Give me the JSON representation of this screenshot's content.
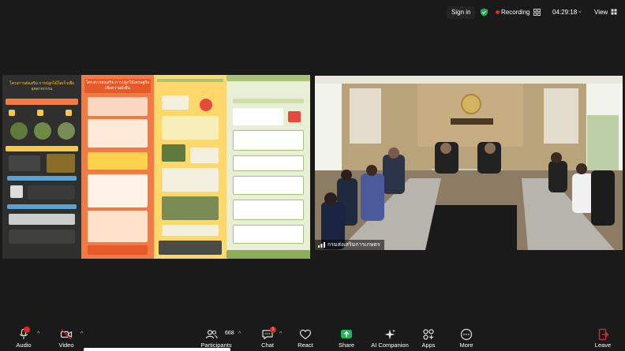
{
  "topbar": {
    "signin": "Sign in",
    "recording": "Recording",
    "time": "04:29:18",
    "view": "View"
  },
  "icons": {
    "shield": "shield-check-icon",
    "grid": "grid-icon",
    "view": "view-icon",
    "audio": "microphone-icon",
    "video": "video-off-icon",
    "participants": "participants-icon",
    "chat": "chat-icon",
    "react": "heart-icon",
    "share": "share-screen-icon",
    "ai": "ai-sparkle-icon",
    "apps": "apps-icon",
    "more": "more-icon",
    "leave": "leave-icon"
  },
  "colors": {
    "bg": "#1a1a1a",
    "recording": "#e02828",
    "share_green": "#25b35a",
    "shield_green": "#23a455"
  },
  "shared_screen": {
    "panels": [
      {
        "title": "โครงการส่งเสริม การปลูกไม้โตเร็วเพื่ออุตสาหกรรม"
      },
      {
        "title": "โครงการส่งเสริม การปลูกไม้เศรษฐกิจเพื่อความยั่งยืน"
      },
      {
        "title": ""
      },
      {
        "title": ""
      }
    ]
  },
  "video": {
    "participant_name": "กรมส่งเสริมการเกษตร",
    "room_sign": "กรมส่งเสริมการเกษตร"
  },
  "toolbar": {
    "audio": "Audio",
    "video": "Video",
    "participants": "Participants",
    "participants_count": "668",
    "chat": "Chat",
    "chat_badge": "1",
    "react": "React",
    "share": "Share",
    "ai_companion": "AI Companion",
    "apps": "Apps",
    "more": "More",
    "leave": "Leave"
  }
}
